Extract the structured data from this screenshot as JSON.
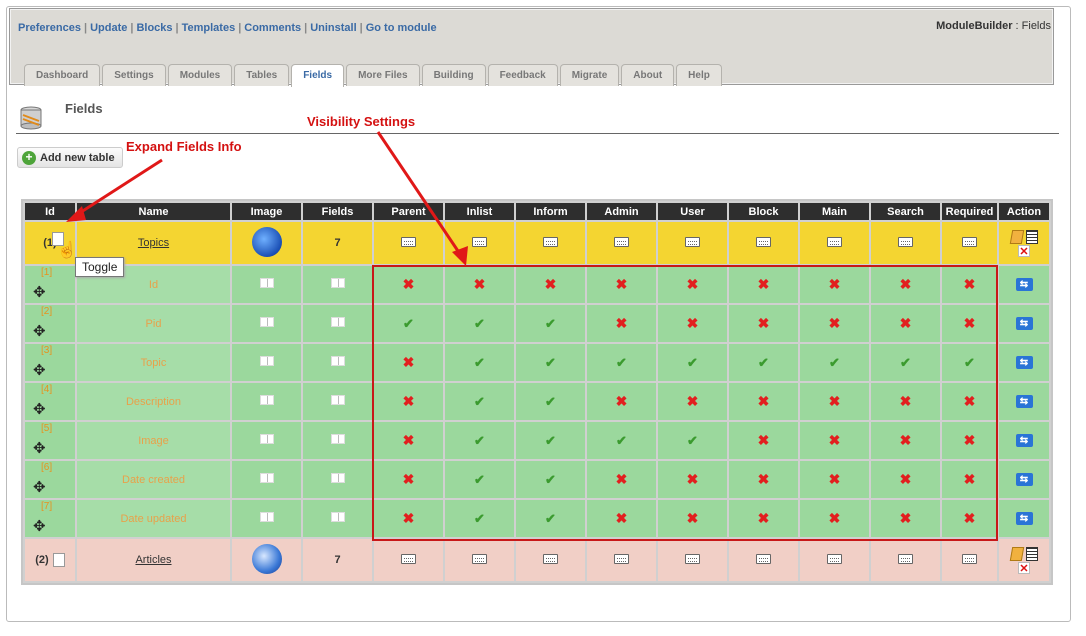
{
  "top_links": [
    "Preferences",
    "Update",
    "Blocks",
    "Templates",
    "Comments",
    "Uninstall",
    "Go to module"
  ],
  "brand": {
    "name": "ModuleBuilder",
    "section": "Fields"
  },
  "tabs": [
    "Dashboard",
    "Settings",
    "Modules",
    "Tables",
    "Fields",
    "More Files",
    "Building",
    "Feedback",
    "Migrate",
    "About",
    "Help"
  ],
  "active_tab": "Fields",
  "page_title": "Fields",
  "add_button": "Add new table",
  "annotations": {
    "expand": "Expand Fields Info",
    "visibility": "Visibility Settings"
  },
  "tooltip": "Toggle",
  "columns": [
    "Id",
    "Name",
    "Image",
    "Fields",
    "Parent",
    "Inlist",
    "Inform",
    "Admin",
    "User",
    "Block",
    "Main",
    "Search",
    "Required",
    "Action"
  ],
  "tables": [
    {
      "id": "(1)",
      "name": "Topics",
      "fields_count": "7",
      "image_icon": "topics-folder-icon"
    },
    {
      "id": "(2)",
      "name": "Articles",
      "fields_count": "7",
      "image_icon": "articles-pen-icon"
    }
  ],
  "fields": [
    {
      "id": "[1]",
      "name": "Id",
      "flags": [
        false,
        false,
        false,
        false,
        false,
        false,
        false,
        false,
        false
      ]
    },
    {
      "id": "[2]",
      "name": "Pid",
      "flags": [
        true,
        true,
        true,
        false,
        false,
        false,
        false,
        false,
        false
      ]
    },
    {
      "id": "[3]",
      "name": "Topic",
      "flags": [
        false,
        true,
        true,
        true,
        true,
        true,
        true,
        true,
        true
      ]
    },
    {
      "id": "[4]",
      "name": "Description",
      "flags": [
        false,
        true,
        true,
        false,
        false,
        false,
        false,
        false,
        false
      ]
    },
    {
      "id": "[5]",
      "name": "Image",
      "flags": [
        false,
        true,
        true,
        true,
        true,
        false,
        false,
        false,
        false
      ]
    },
    {
      "id": "[6]",
      "name": "Date created",
      "flags": [
        false,
        true,
        true,
        false,
        false,
        false,
        false,
        false,
        false
      ]
    },
    {
      "id": "[7]",
      "name": "Date updated",
      "flags": [
        false,
        true,
        true,
        false,
        false,
        false,
        false,
        false,
        false
      ]
    }
  ],
  "colors": {
    "annotation": "#d41111",
    "table_row": "#f4d531",
    "articles_row": "#f1cfc6",
    "field_row": "#9bd89d",
    "header": "#2e2e2e",
    "link": "#3a6aa5"
  }
}
